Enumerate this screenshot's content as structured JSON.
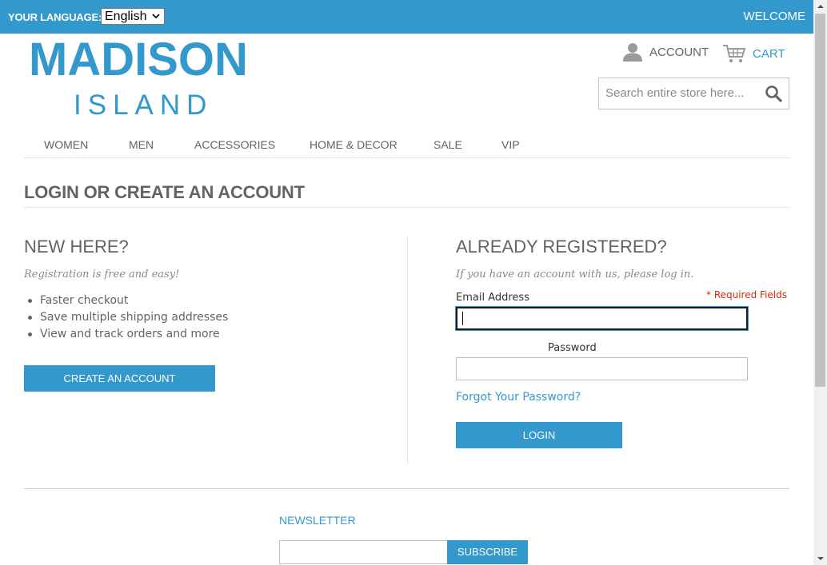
{
  "topbar": {
    "language_label": "YOUR LANGUAGE:",
    "language_value": "English",
    "welcome": "WELCOME"
  },
  "logo": {
    "line1": "MADISON",
    "line2": "ISLAND"
  },
  "header": {
    "account_label": "ACCOUNT",
    "cart_label": "CART",
    "search_placeholder": "Search entire store here..."
  },
  "nav": {
    "items": [
      {
        "label": "WOMEN"
      },
      {
        "label": "MEN"
      },
      {
        "label": "ACCESSORIES"
      },
      {
        "label": "HOME & DECOR"
      },
      {
        "label": "SALE"
      },
      {
        "label": "VIP"
      }
    ]
  },
  "page": {
    "title": "LOGIN OR CREATE AN ACCOUNT"
  },
  "new_customer": {
    "title": "NEW HERE?",
    "subtitle": "Registration is free and easy!",
    "benefits": [
      "Faster checkout",
      "Save multiple shipping addresses",
      "View and track orders and more"
    ],
    "button_label": "CREATE AN ACCOUNT"
  },
  "login": {
    "title": "ALREADY REGISTERED?",
    "subtitle": "If you have an account with us, please log in.",
    "required_note": "* Required Fields",
    "email_label": "Email Address",
    "email_value": "",
    "password_label": "Password",
    "password_value": "",
    "forgot_link": "Forgot Your Password?",
    "button_label": "LOGIN"
  },
  "footer": {
    "newsletter_title": "NEWSLETTER",
    "subscribe_label": "SUBSCRIBE"
  },
  "colors": {
    "brand": "#3399cc",
    "text": "#636363",
    "required": "#df280a"
  }
}
